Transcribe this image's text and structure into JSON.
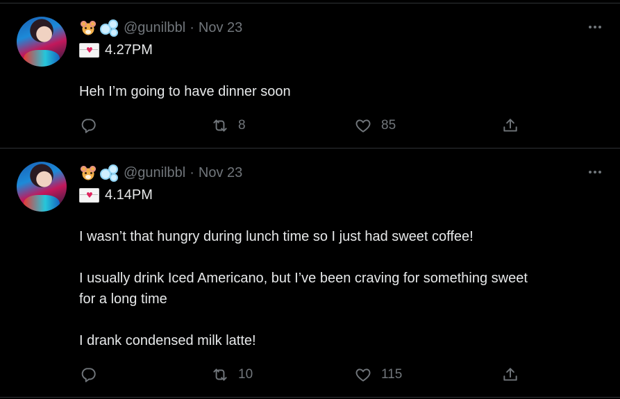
{
  "tweets": [
    {
      "handle": "@gunilbbl",
      "separator": "·",
      "date": "Nov 23",
      "time": "4.27PM",
      "body": [
        "Heh I’m going to have dinner soon"
      ],
      "replies": "",
      "retweets": "8",
      "likes": "85",
      "share": ""
    },
    {
      "handle": "@gunilbbl",
      "separator": "·",
      "date": "Nov 23",
      "time": "4.14PM",
      "body": [
        "I wasn’t that hungry during lunch time so I just had sweet coffee!",
        "I usually drink Iced Americano, but I’ve been craving for something sweet",
        "for a long time",
        "I drank condensed milk latte!"
      ],
      "replies": "",
      "retweets": "10",
      "likes": "115",
      "share": ""
    }
  ],
  "icons": {
    "name_emojis": [
      "hamster-face-icon",
      "bubbles-icon"
    ],
    "time_emoji": "love-letter-icon",
    "more": "more-dots-icon",
    "reply": "reply-icon",
    "retweet": "retweet-icon",
    "like": "like-heart-icon",
    "share": "share-icon"
  },
  "colors": {
    "background": "#000000",
    "text": "#e7e9ea",
    "muted": "#71767b",
    "divider": "#2f3336"
  }
}
